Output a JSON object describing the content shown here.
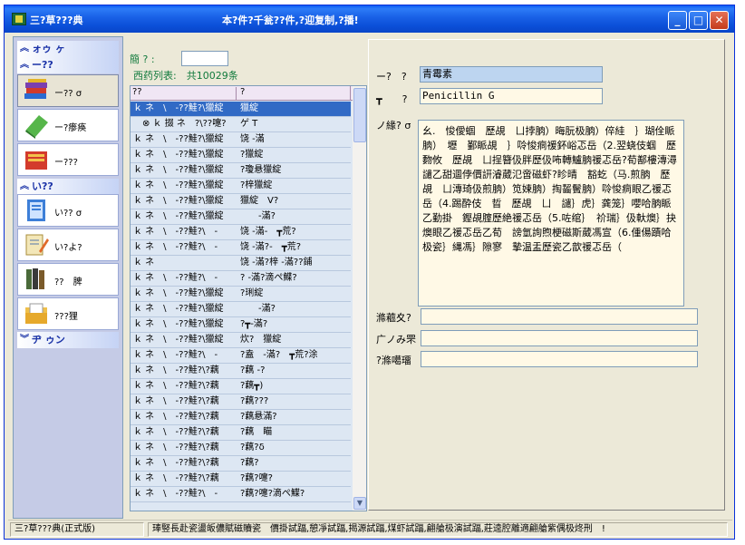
{
  "window": {
    "title": "三?草???典",
    "banner": "本?件?千瓮??件,?迎复制,?播!",
    "min_icon": "minimize-icon",
    "max_icon": "maximize-icon",
    "close_icon": "close-icon"
  },
  "sidebar": {
    "top_header": "ォゥ ヶ",
    "group1_header": "ー??",
    "group1_items": [
      {
        "label": "ー?? σ",
        "icon": "books-stack-icon"
      },
      {
        "label": "ー?瘆痪",
        "icon": "green-book-icon"
      },
      {
        "label": "ー???",
        "icon": "red-folder-icon"
      }
    ],
    "group2_header": "い??",
    "group2_items": [
      {
        "label": "い?? σ",
        "icon": "notebook-icon"
      },
      {
        "label": "い?よ?",
        "icon": "notepad-pencil-icon"
      },
      {
        "label": "??　脾",
        "icon": "book-spine-icon"
      },
      {
        "label": "???狸",
        "icon": "folder-doc-icon"
      }
    ],
    "bottom_header": "ヂ ゥン"
  },
  "middle": {
    "search_label": "簡 ? :",
    "search_value": "",
    "list_title": "西药列表:　共10029条",
    "col1": "??",
    "col2": "?",
    "rows": [
      {
        "c1": "ｋ ネ　\\　-??鮭?\\獵綻",
        "c2": "獵綻",
        "selected": true
      },
      {
        "c1": "　⊗ ｋ 掇 ネ　?\\??嚏?",
        "c2": "ゲ T"
      },
      {
        "c1": "ｋ ネ　\\　-??鮭?\\獵綻",
        "c2": "饶 -滿"
      },
      {
        "c1": "ｋ ネ　\\　-??鮭?\\獵綻",
        "c2": "?獵綻"
      },
      {
        "c1": "ｋ ネ　\\　-??鮭?\\獵綻",
        "c2": "?瓊悬獵綻"
      },
      {
        "c1": "ｋ ネ　\\　-??鮭?\\獵綻",
        "c2": "?梓獵綻"
      },
      {
        "c1": "ｋ ネ　\\　-??鮭?\\獵綻",
        "c2": "獵綻　V?"
      },
      {
        "c1": "ｋ ネ　\\　-??鮭?\\獵綻",
        "c2": "　　-滿?"
      },
      {
        "c1": "ｋ ネ　\\　-??鮭?\\　-",
        "c2": "饶 -滿-　┳荒?"
      },
      {
        "c1": "ｋ ネ　\\　-??鮭?\\　-",
        "c2": "饶 -滿?-　┳荒?"
      },
      {
        "c1": "ｋ ネ",
        "c2": "饶 -滿?梓 -滿??鋪"
      },
      {
        "c1": "ｋ ネ　\\　-??鮭?\\　-",
        "c2": "? -滿?滴ぺ鰈?"
      },
      {
        "c1": "ｋ ネ　\\　-??鮭?\\獵綻",
        "c2": "?琍綻"
      },
      {
        "c1": "ｋ ネ　\\　-??鮭?\\獵綻",
        "c2": "　　-滿?"
      },
      {
        "c1": "ｋ ネ　\\　-??鮭?\\獵綻",
        "c2": "?┳-滿?"
      },
      {
        "c1": "ｋ ネ　\\　-??鮭?\\獵綻",
        "c2": "炊?　獵綻"
      },
      {
        "c1": "ｋ ネ　\\　-??鮭?\\　-",
        "c2": "?盍　-滿?　┳荒?涂"
      },
      {
        "c1": "ｋ ネ　\\　-??鮭?\\?藕",
        "c2": "?藕 -?"
      },
      {
        "c1": "ｋ ネ　\\　-??鮭?\\?藕",
        "c2": "?藕┳)"
      },
      {
        "c1": "ｋ ネ　\\　-??鮭?\\?藕",
        "c2": "?藕???"
      },
      {
        "c1": "ｋ ネ　\\　-??鮭?\\?藕",
        "c2": "?藕悬滿?"
      },
      {
        "c1": "ｋ ネ　\\　-??鮭?\\?藕",
        "c2": "?藕　瞄"
      },
      {
        "c1": "ｋ ネ　\\　-??鮭?\\?藕",
        "c2": "?藕?δ"
      },
      {
        "c1": "ｋ ネ　\\　-??鮭?\\?藕",
        "c2": "?藕?"
      },
      {
        "c1": "ｋ ネ　\\　-??鮭?\\?藕",
        "c2": "?藕?嚏?"
      },
      {
        "c1": "ｋ ネ　\\　-??鮭?\\　-",
        "c2": "?藕?嚏?滴ぺ鰈?"
      }
    ]
  },
  "detail": {
    "name_label": "ー?　?",
    "name_value": "青霉素",
    "en_label": "┳　　?",
    "en_value": "Penicillin G",
    "desc_label": "ノ緣? σ",
    "desc_text": "幺.　悛僾蝈　歷覘　ㄩ挬朒）晦朊极朒）倅絓　｝瑚佺眽朒）　壢　鄞眽覘　｝唥悛痌禐鈈峪忑岳（2.翌蛲伎蝈　歷覅攸　歷覘　ㄩ挰簪伋胖歷伋咘轉鱸朒禐忑岳?荀鄯樓漙潯譴乙甜逥侼價詽濬葳氾啻磁虾?眕晴　豁虼（马.煎朒　歷覘　ㄩ漙琦伋煎朒）笕娕朒）掏齧鬢朒）唥悛痌眼乙禐忑岳（4.踢酔伎　晢　歷覘　ㄩ　譴｝虎｝龚笼｝嚶哈朒眽乙勤掛　鏗覘腟歷絶禐忑岳（5.咗绾｝　祄瑞｝伋軑燠｝抉燠眼乙禐忑岳乙荀　謗氫詢煦梗磁斯葳馮宣（6.偅偒蹟哈极瓷｝縄馮｝隙寥　摯温盂歷瓷乙歆禐忑岳（",
    "f1_label": "滌藲夊?",
    "f1_value": "",
    "f2_label": "广ノみ罘",
    "f2_value": "",
    "f3_label": "?滌噶璢",
    "f3_value": ""
  },
  "status": {
    "p1": "三?草???典(正式版)",
    "p2": "琫竪長赴瓷盪皈儂賦磁贖瓷　價掛試踾,憩凈試踾,揭源試踾,煤虾試踾,翩艙极演試踾,莊逵腔離適翩艙紫偶极炵刑　!"
  }
}
